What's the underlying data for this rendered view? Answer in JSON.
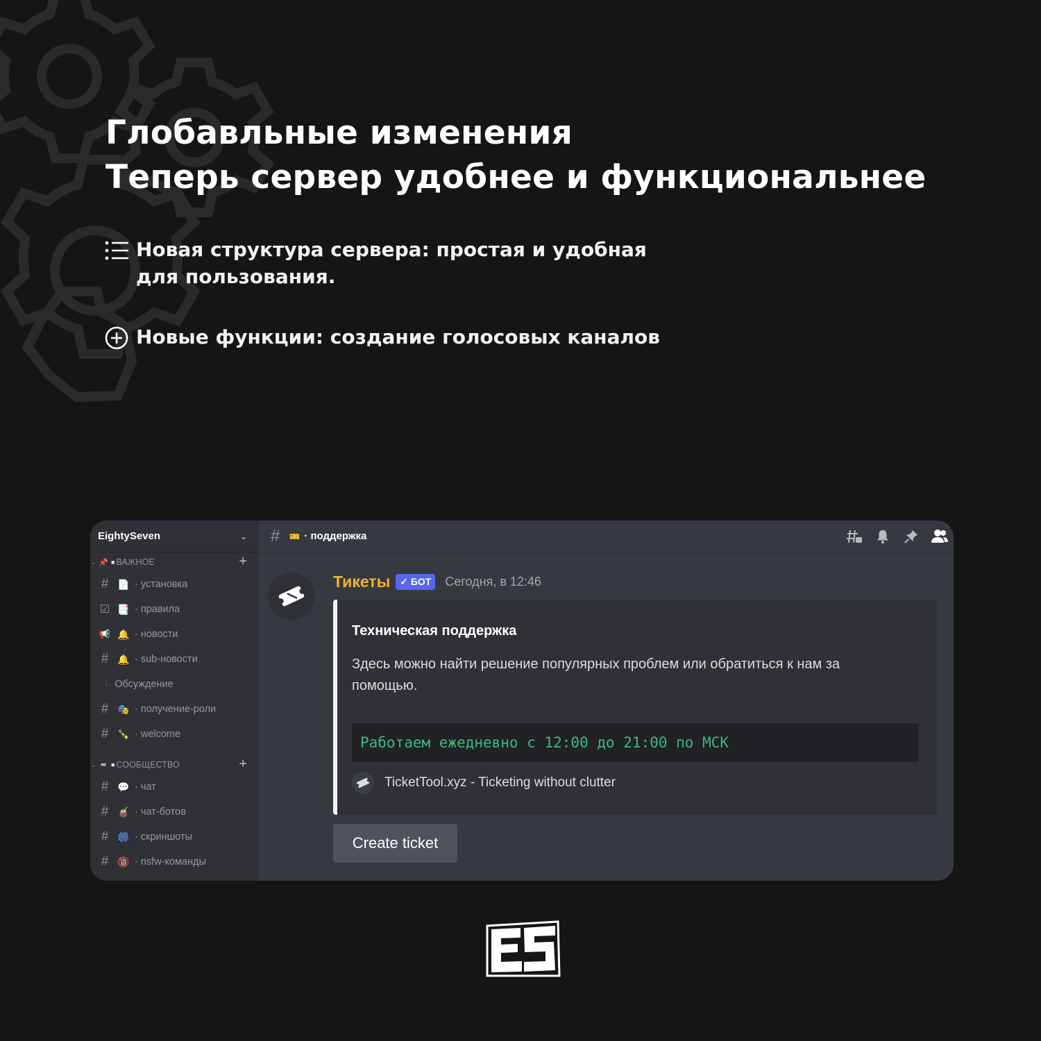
{
  "headline": {
    "line1": "Глобавльные изменения",
    "line2": "Теперь сервер удобнее и функциональнее"
  },
  "features": [
    {
      "icon": "list-icon",
      "text": "Новая структура сервера: простая и удобная для пользования."
    },
    {
      "icon": "plus-circle-icon",
      "text": "Новые функции: создание голосовых каналов"
    }
  ],
  "discord": {
    "server_name": "EightySeven",
    "categories": [
      {
        "label": "ВАЖНОЕ",
        "channels": [
          {
            "icon": "#",
            "emoji": "📄",
            "name": "установка"
          },
          {
            "icon": "☑",
            "emoji": "📑",
            "name": "правила"
          },
          {
            "icon": "📢",
            "emoji": "🔔",
            "name": "новости"
          },
          {
            "icon": "#",
            "emoji": "🔔",
            "name": "sub-новости"
          }
        ],
        "thread": "Обсуждение",
        "channels_after": [
          {
            "icon": "#",
            "emoji": "🎭",
            "name": "получение-роли"
          },
          {
            "icon": "#",
            "emoji": "🍾",
            "name": "welcome"
          }
        ]
      },
      {
        "label": "СООБЩЕСТВО",
        "channels": [
          {
            "icon": "#",
            "emoji": "💬",
            "name": "чат"
          },
          {
            "icon": "#",
            "emoji": "🧉",
            "name": "чат-ботов"
          },
          {
            "icon": "#",
            "emoji": "🎆",
            "name": "скриншоты"
          },
          {
            "icon": "#",
            "emoji": "🔞",
            "name": "nsfw-команды"
          }
        ]
      }
    ],
    "current_channel": {
      "emoji": "🎫",
      "name": "поддержка"
    },
    "message": {
      "author": "Тикеты",
      "badge": "✓ БОТ",
      "timestamp": "Сегодня, в 12:46",
      "embed": {
        "title": "Техническая поддержка",
        "description": "Здесь можно найти решение популярных проблем или обратиться к нам за помощью.",
        "code": "Работаем ежедневно с 12:00 до 21:00 по МСК",
        "footer": "TicketTool.xyz - Ticketing without clutter"
      },
      "button": "Create ticket"
    },
    "toolbar_icons": [
      "threads-icon",
      "bell-icon",
      "pin-icon",
      "members-icon"
    ]
  },
  "colors": {
    "background": "#151515",
    "author": "#f0b232",
    "badge": "#5865f2",
    "code": "#43b581"
  }
}
